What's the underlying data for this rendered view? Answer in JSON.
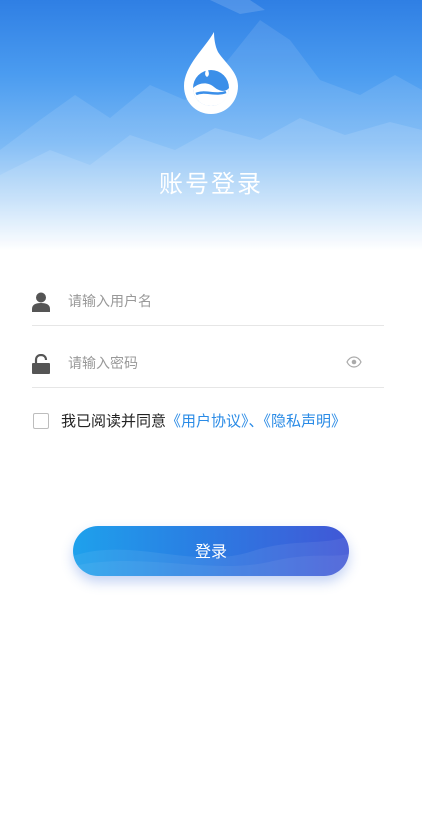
{
  "header": {
    "title": "账号登录",
    "logo_icon": "water-drop-logo"
  },
  "form": {
    "username": {
      "placeholder": "请输入用户名",
      "value": "",
      "icon": "user-icon"
    },
    "password": {
      "placeholder": "请输入密码",
      "value": "",
      "icon": "lock-icon",
      "toggle_icon": "eye-icon"
    }
  },
  "agreement": {
    "prefix": "我已阅读并同意",
    "user_agreement": "《用户协议》",
    "separator": "、",
    "privacy_policy": "《隐私声明》",
    "checked": false
  },
  "login_button": {
    "label": "登录"
  },
  "colors": {
    "primary": "#2a8be6",
    "header_top": "#2f7fe4",
    "button_start": "#1ea1ec",
    "button_end": "#4157d6"
  }
}
